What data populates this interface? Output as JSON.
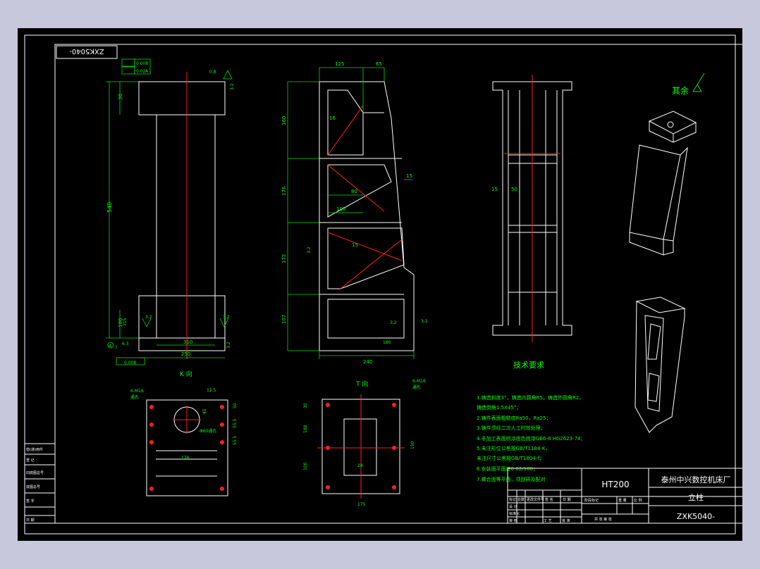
{
  "drawing": {
    "part_no_box": "ZXK5040-",
    "view_k_label": "K 向",
    "view_t_label": "T 向",
    "surface_rest": "其余",
    "material": "HT200",
    "company": "泰州中兴数控机床厂",
    "part_name": "立柱",
    "drawing_no": "ZXK5040-",
    "tech_title": "技术要求",
    "tech_notes": [
      "1.铸造斜度3°，铸造内圆角R5，铸造外圆角R2，",
      "   铸造倒角1.5X45°；",
      "2.铸件表面粗糙度Ra50，Ra25；",
      "3.铸件须经二次人工时效处理；",
      "4.非加工表面喷涂底色底漆GB6-8 HG2623-74；",
      "5.未注形位公差按GB/T1184-K，",
      "   未注尺寸公差按GB/T1804-f；",
      "6.安装面平面度0.02/100；",
      "7.螺合面等平面，须刮研及配对"
    ],
    "dims_left": {
      "d1": "0.008",
      "d2": "0.02",
      "d3": "A",
      "top_ra": "0.8",
      "top_ra2": "3.2",
      "h_top": "30",
      "h_total": "540",
      "h_bot": "100",
      "w_inner": "310",
      "w_base": "250",
      "side": "315",
      "flat": "0.008",
      "ra_l": "3.2",
      "ra_r": "3.2",
      "ra_b": "6.3",
      "ra_b2": "3.2",
      "datum": "A"
    },
    "dims_mid": {
      "top1": "125",
      "top2": "65",
      "v1": "160",
      "v2": "176",
      "v3": "172",
      "v4": "107",
      "rib1": "16",
      "w80": "80",
      "w100": "100",
      "t15": "15",
      "rib2": "15",
      "bottom": "240",
      "ra_s": "3.2",
      "ra_bl": "3.2",
      "ra_br": "3.2",
      "corner": "180"
    },
    "dims_right": {
      "d15": "15",
      "d50": "50"
    },
    "dims_k": {
      "holes": "6-M16",
      "holes2": "通孔",
      "d1": "12.5",
      "d2": "45",
      "d3": "50",
      "d4": "55.5",
      "d5": "55.5",
      "bore": "Φ60通孔",
      "w": "176"
    },
    "dims_t": {
      "holes": "6-M16",
      "holes2": "通孔",
      "h1": "30",
      "h2": "188",
      "h3": "100",
      "c": "28",
      "w": "175",
      "r": "150"
    },
    "title_block": {
      "rev_cols": [
        "标记",
        "处数",
        "更改文件号",
        "签 名",
        "日 期"
      ],
      "roles": [
        "设 计",
        "标准化",
        "审 核",
        "工 艺",
        "批 准"
      ],
      "stage_cols": [
        "阶段标记",
        "重 量",
        "比 例"
      ],
      "sheet": "共  张   第  张",
      "left_rows": [
        "借(通)用件",
        "登 记",
        "旧底图总号",
        "底图总号",
        "签 字",
        "日 期"
      ]
    },
    "colors": {
      "line": "#ffffff",
      "dim": "#00e000",
      "center": "#ff2020",
      "text": "#00ff00",
      "company_text": "#ffffff"
    }
  }
}
